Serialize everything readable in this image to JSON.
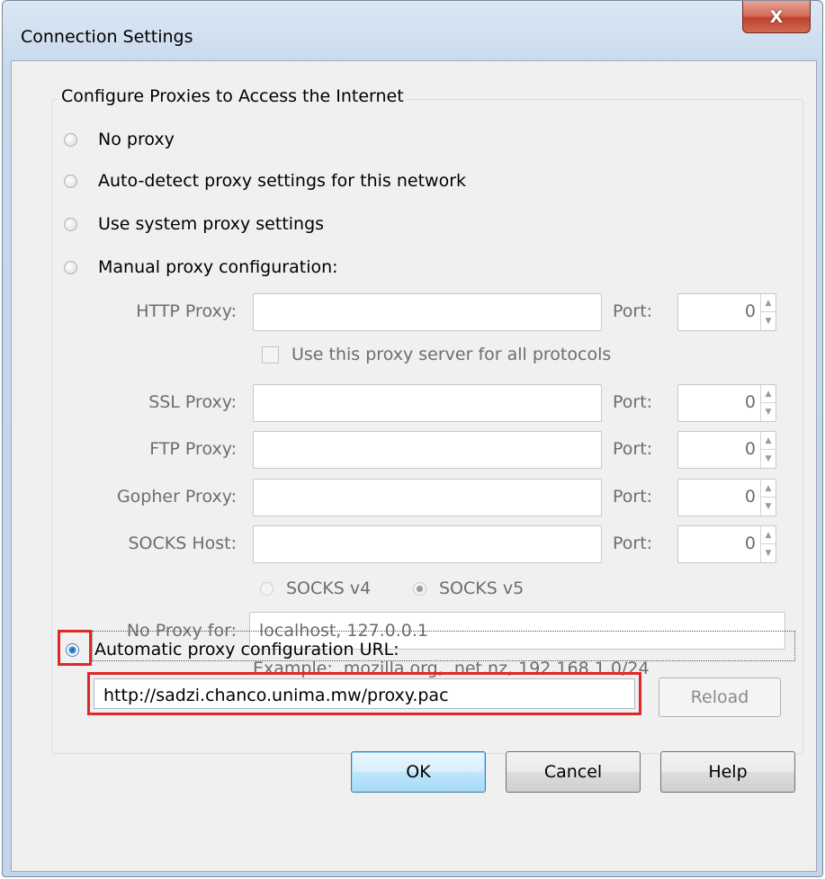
{
  "window": {
    "title": "Connection Settings",
    "close_glyph": "X"
  },
  "group": {
    "legend": "Configure Proxies to Access the Internet"
  },
  "options": {
    "no_proxy": "No proxy",
    "auto_detect": "Auto-detect proxy settings for this network",
    "system": "Use system proxy settings",
    "manual": "Manual proxy configuration:",
    "auto_url": "Automatic proxy configuration URL:",
    "selected": "auto_url"
  },
  "manual": {
    "http_label": "HTTP Proxy:",
    "http_value": "",
    "http_port_label": "Port:",
    "http_port": "0",
    "use_all_label": "Use this proxy server for all protocols",
    "ssl_label": "SSL Proxy:",
    "ssl_value": "",
    "ssl_port_label": "Port:",
    "ssl_port": "0",
    "ftp_label": "FTP Proxy:",
    "ftp_value": "",
    "ftp_port_label": "Port:",
    "ftp_port": "0",
    "gopher_label": "Gopher Proxy:",
    "gopher_value": "",
    "gopher_port_label": "Port:",
    "gopher_port": "0",
    "socks_label": "SOCKS Host:",
    "socks_value": "",
    "socks_port_label": "Port:",
    "socks_port": "0",
    "socks_v4": "SOCKS v4",
    "socks_v5": "SOCKS v5",
    "no_proxy_label": "No Proxy for:",
    "no_proxy_value": "localhost, 127.0.0.1",
    "example": "Example: .mozilla.org, .net.nz, 192.168.1.0/24"
  },
  "auto": {
    "url": "http://sadzi.chanco.unima.mw/proxy.pac",
    "reload_label": "Reload"
  },
  "buttons": {
    "ok": "OK",
    "cancel": "Cancel",
    "help": "Help"
  },
  "icons": {
    "close": "close-icon",
    "spin_up": "spin-up-arrow",
    "spin_down": "spin-down-arrow"
  },
  "colors": {
    "highlight": "#e02828",
    "dialog_bg": "#f0f0f0",
    "titlebar": "#c7d8eb"
  }
}
